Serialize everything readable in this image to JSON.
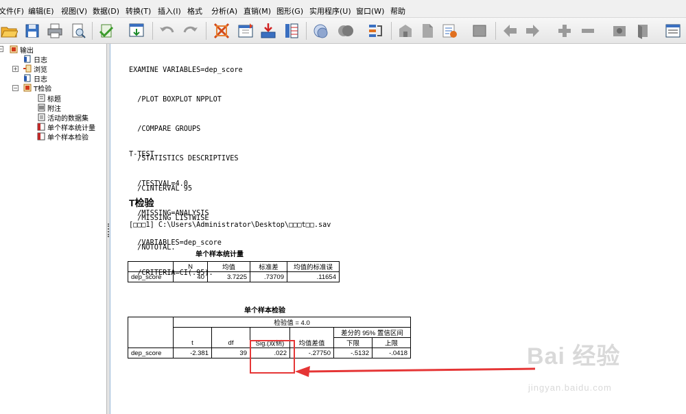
{
  "menu": [
    "文件(F)",
    "编辑(E)",
    "视图(V)",
    "数据(D)",
    "转换(T)",
    "插入(I)",
    "格式",
    "分析(A)",
    "直销(M)",
    "图形(G)",
    "实用程序(U)",
    "窗口(W)",
    "帮助"
  ],
  "toolbar": {
    "icons": [
      "open-icon",
      "save-icon",
      "print-icon",
      "print-preview-icon",
      "export-icon",
      "recall-dialog-icon",
      "undo-icon",
      "redo-icon",
      "goto-case-icon",
      "goto-variable-icon",
      "insert-cases-icon",
      "insert-variable-icon",
      "split-file-icon",
      "weight-cases-icon",
      "select-cases-icon",
      "designate-window-icon",
      "insert-output-icon",
      "insert-heading-icon",
      "insert-title-icon",
      "insert-text-icon",
      "promote-icon",
      "demote-icon",
      "expand-icon",
      "collapse-icon",
      "show-icon",
      "hide-icon",
      "scroll-icon"
    ]
  },
  "outline": {
    "items": [
      {
        "label": "输出",
        "icon": "output-root-icon"
      },
      {
        "label": "日志",
        "icon": "log-icon"
      },
      {
        "label": "浏览",
        "icon": "explore-icon"
      },
      {
        "label": "日志",
        "icon": "log-icon"
      },
      {
        "label": "T检验",
        "icon": "t-test-icon"
      },
      {
        "label": "标题",
        "icon": "title-icon"
      },
      {
        "label": "附注",
        "icon": "notes-icon"
      },
      {
        "label": "活动的数据集",
        "icon": "dataset-icon"
      },
      {
        "label": "单个样本统计量",
        "icon": "table-icon"
      },
      {
        "label": "单个样本检验",
        "icon": "table-icon"
      }
    ]
  },
  "content": {
    "syntax1": [
      "EXAMINE VARIABLES=dep_score",
      "  /PLOT BOXPLOT NPPLOT",
      "  /COMPARE GROUPS",
      "  /STATISTICS DESCRIPTIVES",
      "  /CINTERVAL 95",
      "  /MISSING LISTWISE",
      "  /NOTOTAL."
    ],
    "syntax2": [
      "T-TEST",
      "  /TESTVAL=4.0",
      "  /MISSING=ANALYSIS",
      "  /VARIABLES=dep_score",
      "  /CRITERIA=CI(.95)."
    ],
    "heading": "T检验",
    "dataset_path": "[□□□1] C:\\Users\\Administrator\\Desktop\\□□□t□□.sav",
    "table1": {
      "title": "单个样本统计量",
      "headers": [
        "",
        "N",
        "均值",
        "标准差",
        "均值的标准误"
      ],
      "rows": [
        [
          "dep_score",
          "40",
          "3.7225",
          ".73709",
          ".11654"
        ]
      ]
    },
    "table2": {
      "title": "单个样本检验",
      "test_value": "检验值 = 4.0",
      "ci_header": "差分的 95% 置信区间",
      "headers": [
        "t",
        "df",
        "Sig.(双侧)",
        "均值差值",
        "下限",
        "上限"
      ],
      "rows": [
        [
          "dep_score",
          "-2.381",
          "39",
          ".022",
          "-.27750",
          "-.5132",
          "-.0418"
        ]
      ]
    }
  },
  "watermark": {
    "big": "Bai 经验",
    "small": "jingyan.baidu.com"
  },
  "colors": {
    "highlight": "#e53535"
  }
}
